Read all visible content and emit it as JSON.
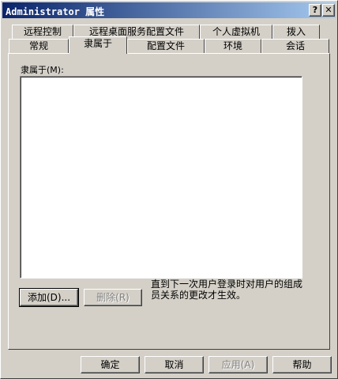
{
  "window": {
    "title": "Administrator 属性",
    "help_button": "?",
    "close_button": "✕"
  },
  "tabs": {
    "row1": [
      "远程控制",
      "远程桌面服务配置文件",
      "个人虚拟机",
      "拨入"
    ],
    "row2": [
      "常规",
      "隶属于",
      "配置文件",
      "环境",
      "会话"
    ],
    "active": "隶属于"
  },
  "member_of": {
    "label": "隶属于(M):",
    "items": []
  },
  "buttons": {
    "add": "添加(D)...",
    "remove": "删除(R)",
    "ok": "确定",
    "cancel": "取消",
    "apply": "应用(A)",
    "help": "帮助"
  },
  "note": "直到下一次用户登录时对用户的组成员关系的更改才生效。"
}
